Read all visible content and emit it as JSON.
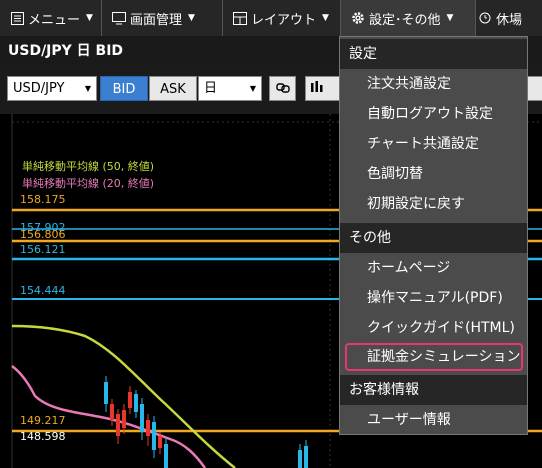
{
  "topbar": {
    "menu_label": "メニュー",
    "screen_label": "画面管理",
    "layout_label": "レイアウト",
    "settings_label": "設定･その他",
    "holiday_label": "休場"
  },
  "chart": {
    "title": "USD/JPY 日 BID",
    "symbol": "USD/JPY",
    "bid_label": "BID",
    "ask_label": "ASK",
    "timeframe": "日",
    "legend": [
      {
        "text": "単純移動平均線 (50, 終値)",
        "color": "#c8d83c"
      },
      {
        "text": "単純移動平均線 (20, 終値)",
        "color": "#e87ab8"
      }
    ],
    "price_labels": {
      "p1": "158.175",
      "p2": "157.902",
      "p3": "156.806",
      "p4": "156.121",
      "p5": "154.444",
      "p6": "149.217",
      "p7": "148.598"
    },
    "colors": {
      "orange": "#f0a820",
      "cyan": "#29b6e8",
      "ma50": "#c8d83c",
      "ma20": "#e87ab8"
    }
  },
  "menu": {
    "sections": [
      {
        "title": "設定",
        "items": [
          "注文共通設定",
          "自動ログアウト設定",
          "チャート共通設定",
          "色調切替",
          "初期設定に戻す"
        ]
      },
      {
        "title": "その他",
        "items": [
          "ホームページ",
          "操作マニュアル(PDF)",
          "クイックガイド(HTML)",
          "証拠金シミュレーション"
        ]
      },
      {
        "title": "お客様情報",
        "items": [
          "ユーザー情報"
        ]
      }
    ],
    "highlight_color": "#e8376c"
  }
}
